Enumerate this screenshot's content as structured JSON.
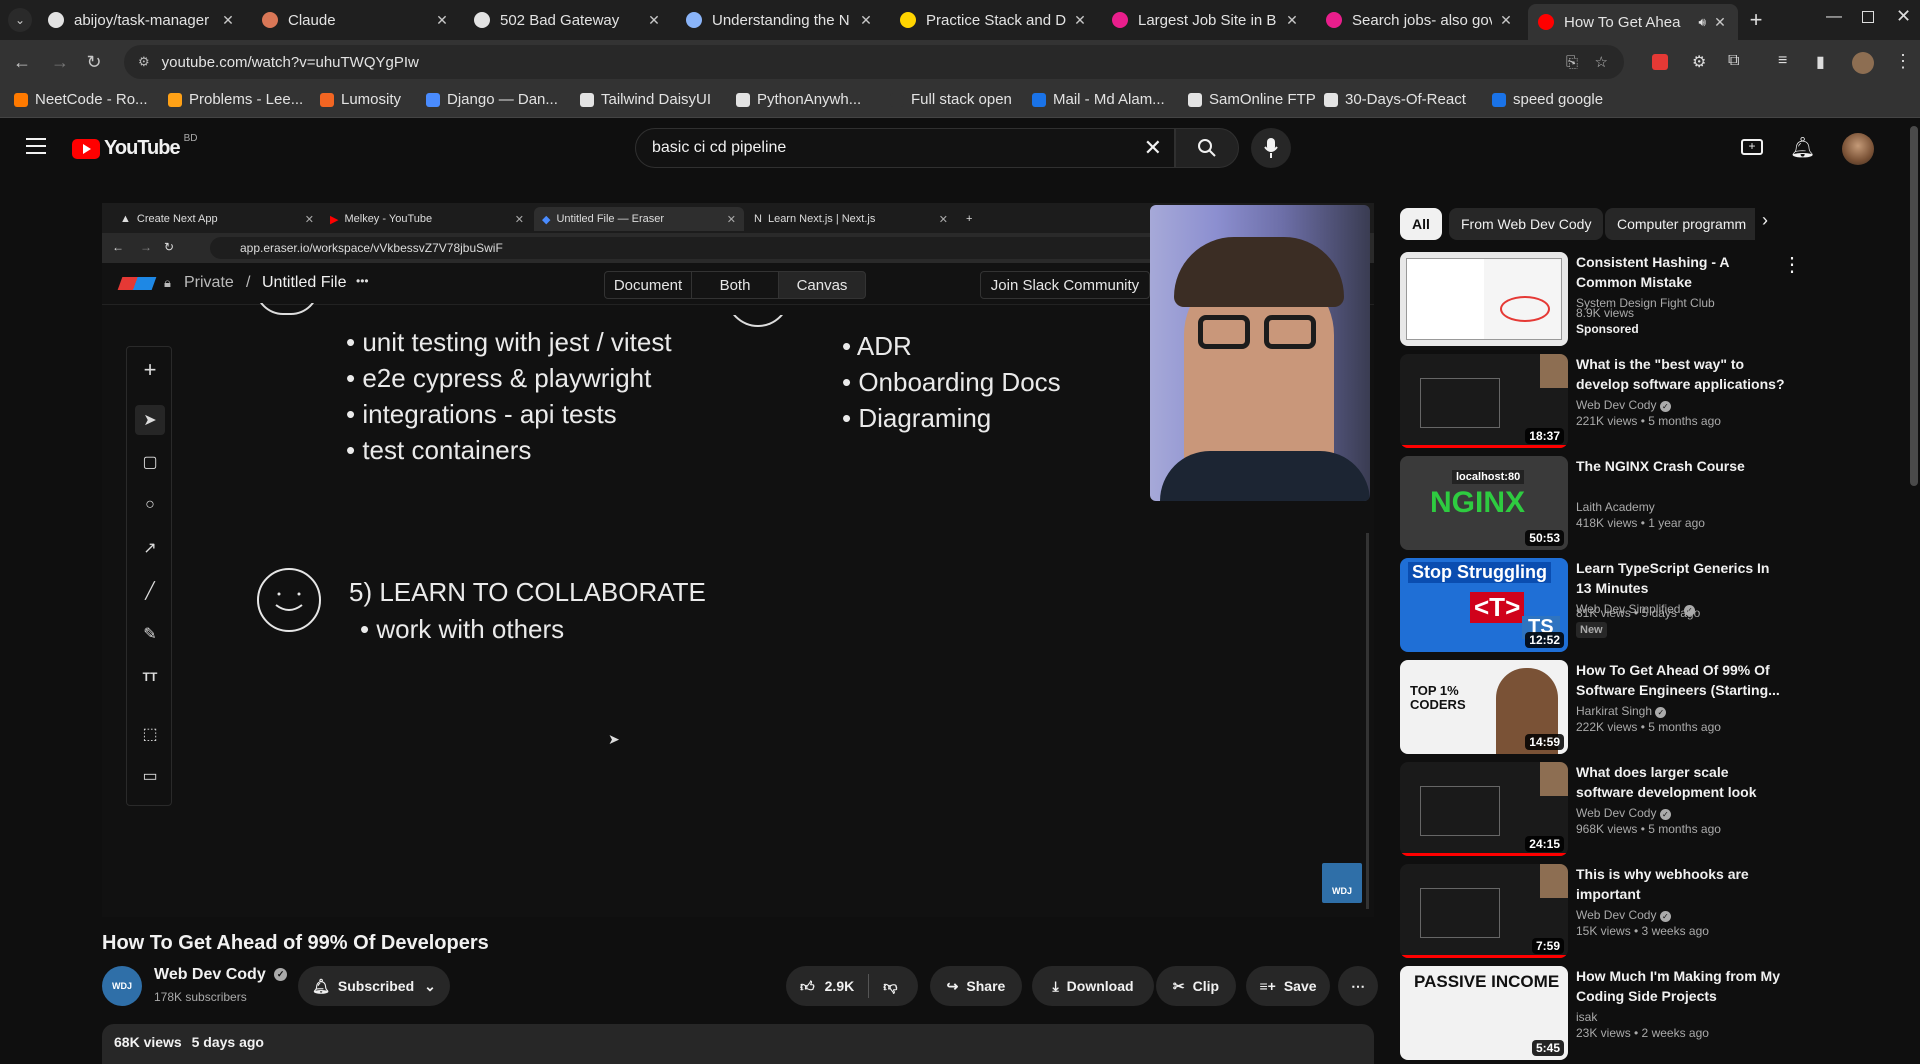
{
  "browser": {
    "tabs": [
      {
        "title": "abijoy/task-manager",
        "icon": "github-icon",
        "color": "#e3e3e3"
      },
      {
        "title": "Claude",
        "icon": "claude-icon",
        "color": "#d97757"
      },
      {
        "title": "502 Bad Gateway",
        "icon": "globe-icon",
        "color": "#e3e3e3"
      },
      {
        "title": "Understanding the N",
        "icon": "globe-icon",
        "color": "#8ab4f8"
      },
      {
        "title": "Practice Stack and D",
        "icon": "practice-icon",
        "color": "#ffd400"
      },
      {
        "title": "Largest Job Site in B",
        "icon": "bdjobs-icon",
        "color": "#e91e8c"
      },
      {
        "title": "Search jobs- also gov",
        "icon": "bdjobs-icon",
        "color": "#e91e8c"
      },
      {
        "title": "How To Get Ahea",
        "icon": "youtube-icon",
        "color": "#ff0000"
      }
    ],
    "new_tab": "+",
    "url": "youtube.com/watch?v=uhuTWQYgPIw",
    "bookmarks": [
      {
        "label": "NeetCode - Ro...",
        "color": "#ff7a00"
      },
      {
        "label": "Problems - Lee...",
        "color": "#ffa116"
      },
      {
        "label": "Lumosity",
        "color": "#f26522"
      },
      {
        "label": "Django — Dan...",
        "color": "#4a8cff"
      },
      {
        "label": "Tailwind DaisyUI",
        "color": "#e3e3e3"
      },
      {
        "label": "PythonAnywh...",
        "color": "#e3e3e3"
      },
      {
        "label": "Full stack open",
        "color": "#333333"
      },
      {
        "label": "Mail - Md Alam...",
        "color": "#1a73e8"
      },
      {
        "label": "SamOnline FTP",
        "color": "#e3e3e3"
      },
      {
        "label": "30-Days-Of-React",
        "color": "#e3e3e3"
      },
      {
        "label": "speed google",
        "color": "#1a73e8"
      }
    ]
  },
  "youtube": {
    "logo_text": "YouTube",
    "country": "BD",
    "search_value": "basic ci cd pipeline"
  },
  "video": {
    "inner_tabs": [
      {
        "title": "Create Next App"
      },
      {
        "title": "Melkey - YouTube"
      },
      {
        "title": "Untitled File — Eraser"
      },
      {
        "title": "Learn Next.js | Next.js"
      }
    ],
    "inner_url": "app.eraser.io/workspace/vVkbessvZ7V78jbuSwiF",
    "eraser": {
      "visibility": "Private",
      "separator": "/",
      "file_name": "Untitled File",
      "more": "•••",
      "segments": [
        "Document",
        "Both",
        "Canvas"
      ],
      "slack": "Join Slack Community"
    },
    "canvas_lines_left": [
      "• unit testing with jest / vitest",
      "• e2e cypress & playwright",
      "• integrations - api tests",
      "• test containers"
    ],
    "canvas_lines_right": [
      "• ADR",
      "• Onboarding Docs",
      "• Diagraming"
    ],
    "section_heading": "5) LEARN TO COLLABORATE",
    "section_item": "• work with others",
    "watermark": "WDJ"
  },
  "details": {
    "title": "How To Get Ahead of 99% Of Developers",
    "channel": "Web Dev Cody",
    "subscribers": "178K subscribers",
    "subscribe_label": "Subscribed",
    "likes": "2.9K",
    "share": "Share",
    "download": "Download",
    "clip": "Clip",
    "save": "Save",
    "views": "68K views",
    "age": "5 days ago"
  },
  "chips": [
    "All",
    "From Web Dev Cody",
    "Computer programm"
  ],
  "recommendations": [
    {
      "title": "Consistent Hashing - A Common Mistake",
      "channel": "System Design Fight Club",
      "meta": "8.9K views",
      "badge": "Sponsored",
      "duration": "",
      "thumb": "#e8e8e8"
    },
    {
      "title": "What is the \"best way\" to develop software applications?",
      "channel": "Web Dev Cody",
      "meta": "221K views • 5 months ago",
      "badge": "",
      "duration": "18:37",
      "thumb": "#1a1a1a"
    },
    {
      "title": "The NGINX Crash Course",
      "channel": "Laith Academy",
      "meta": "418K views • 1 year ago",
      "badge": "",
      "duration": "50:53",
      "thumb": "#3a3a3a"
    },
    {
      "title": "Learn TypeScript Generics In 13 Minutes",
      "channel": "Web Dev Simplified",
      "meta": "81K views • 5 days ago",
      "badge": "New",
      "duration": "12:52",
      "thumb": "#1f6fd6"
    },
    {
      "title": "How To Get Ahead Of 99% Of Software Engineers (Starting...",
      "channel": "Harkirat Singh",
      "meta": "222K views • 5 months ago",
      "badge": "",
      "duration": "14:59",
      "thumb": "#f2f2f2"
    },
    {
      "title": "What does larger scale software development look like?",
      "channel": "Web Dev Cody",
      "meta": "968K views • 5 months ago",
      "badge": "",
      "duration": "24:15",
      "thumb": "#1a1a1a"
    },
    {
      "title": "This is why webhooks are important",
      "channel": "Web Dev Cody",
      "meta": "15K views • 3 weeks ago",
      "badge": "",
      "duration": "7:59",
      "thumb": "#1a1a1a"
    },
    {
      "title": "How Much I'm Making from My Coding Side Projects",
      "channel": "isak",
      "meta": "23K views • 2 weeks ago",
      "badge": "",
      "duration": "5:45",
      "thumb": "#f2f2f2"
    }
  ],
  "thumb_texts": {
    "nginx_host": "localhost:80",
    "nginx": "NGINX",
    "ts_top": "Stop Struggling",
    "ts_mid": "<T>",
    "ts_badge": "TS",
    "top_coders": "TOP 1% CODERS",
    "passive": "PASSIVE INCOME"
  },
  "colors": {
    "accent": "#ff0000",
    "background": "#0f0f0f",
    "chip_bg": "#272727"
  }
}
